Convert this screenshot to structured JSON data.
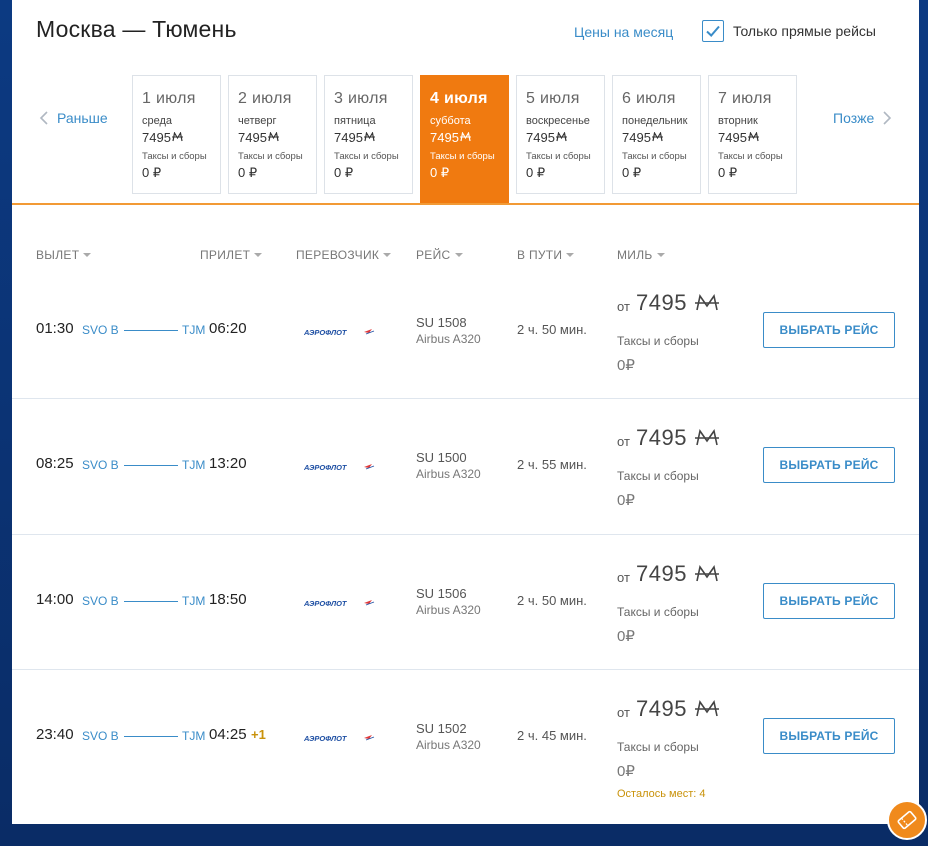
{
  "header": {
    "title": "Москва — Тюмень",
    "month_prices_link": "Цены на месяц",
    "direct_only_label": "Только прямые рейсы",
    "direct_only_checked": true
  },
  "date_nav": {
    "prev_label": "Раньше",
    "next_label": "Позже",
    "days": [
      {
        "date": "1 июля",
        "weekday": "среда",
        "price": "7495",
        "tax_label": "Таксы и сборы",
        "tax": "0 ₽",
        "active": false
      },
      {
        "date": "2 июля",
        "weekday": "четверг",
        "price": "7495",
        "tax_label": "Таксы и сборы",
        "tax": "0 ₽",
        "active": false
      },
      {
        "date": "3 июля",
        "weekday": "пятница",
        "price": "7495",
        "tax_label": "Таксы и сборы",
        "tax": "0 ₽",
        "active": false
      },
      {
        "date": "4 июля",
        "weekday": "суббота",
        "price": "7495",
        "tax_label": "Таксы и сборы",
        "tax": "0 ₽",
        "active": true
      },
      {
        "date": "5 июля",
        "weekday": "воскресенье",
        "price": "7495",
        "tax_label": "Таксы и сборы",
        "tax": "0 ₽",
        "active": false
      },
      {
        "date": "6 июля",
        "weekday": "понедельник",
        "price": "7495",
        "tax_label": "Таксы и сборы",
        "tax": "0 ₽",
        "active": false
      },
      {
        "date": "7 июля",
        "weekday": "вторник",
        "price": "7495",
        "tax_label": "Таксы и сборы",
        "tax": "0 ₽",
        "active": false
      }
    ]
  },
  "columns": {
    "departure": "ВЫЛЕТ",
    "arrival": "ПРИЛЕТ",
    "carrier": "ПЕРЕВОЗЧИК",
    "flight": "РЕЙС",
    "duration": "В ПУТИ",
    "miles": "МИЛЬ"
  },
  "flights": [
    {
      "dep_time": "01:30",
      "dep_code": "SVO B",
      "arr_code": "TJM",
      "arr_time": "06:20",
      "plus_day": "",
      "carrier_name": "АЭРОФЛОТ",
      "flight_no": "SU 1508",
      "aircraft": "Airbus A320",
      "duration": "2 ч. 50 мин.",
      "price_from": "от",
      "price": "7495",
      "tax_label": "Таксы и сборы",
      "tax": "0₽",
      "seats_left": "",
      "button": "ВЫБРАТЬ РЕЙС"
    },
    {
      "dep_time": "08:25",
      "dep_code": "SVO B",
      "arr_code": "TJM",
      "arr_time": "13:20",
      "plus_day": "",
      "carrier_name": "АЭРОФЛОТ",
      "flight_no": "SU 1500",
      "aircraft": "Airbus A320",
      "duration": "2 ч. 55 мин.",
      "price_from": "от",
      "price": "7495",
      "tax_label": "Таксы и сборы",
      "tax": "0₽",
      "seats_left": "",
      "button": "ВЫБРАТЬ РЕЙС"
    },
    {
      "dep_time": "14:00",
      "dep_code": "SVO B",
      "arr_code": "TJM",
      "arr_time": "18:50",
      "plus_day": "",
      "carrier_name": "АЭРОФЛОТ",
      "flight_no": "SU 1506",
      "aircraft": "Airbus A320",
      "duration": "2 ч. 50 мин.",
      "price_from": "от",
      "price": "7495",
      "tax_label": "Таксы и сборы",
      "tax": "0₽",
      "seats_left": "",
      "button": "ВЫБРАТЬ РЕЙС"
    },
    {
      "dep_time": "23:40",
      "dep_code": "SVO B",
      "arr_code": "TJM",
      "arr_time": "04:25",
      "plus_day": "+1",
      "carrier_name": "АЭРОФЛОТ",
      "flight_no": "SU 1502",
      "aircraft": "Airbus A320",
      "duration": "2 ч. 45 мин.",
      "price_from": "от",
      "price": "7495",
      "tax_label": "Таксы и сборы",
      "tax": "0₽",
      "seats_left": "Осталось мест: 4",
      "button": "ВЫБРАТЬ РЕЙС"
    }
  ],
  "icons": {
    "checkbox_check": "check-icon",
    "prev": "chevron-left-icon",
    "next": "chevron-right-icon",
    "miles": "miles-currency-icon",
    "carrier_logo": "aeroflot-logo",
    "floating": "ticket-icon"
  },
  "colors": {
    "accent": "#3a8cc8",
    "active_day": "#f07a10",
    "warning": "#c9920a"
  }
}
